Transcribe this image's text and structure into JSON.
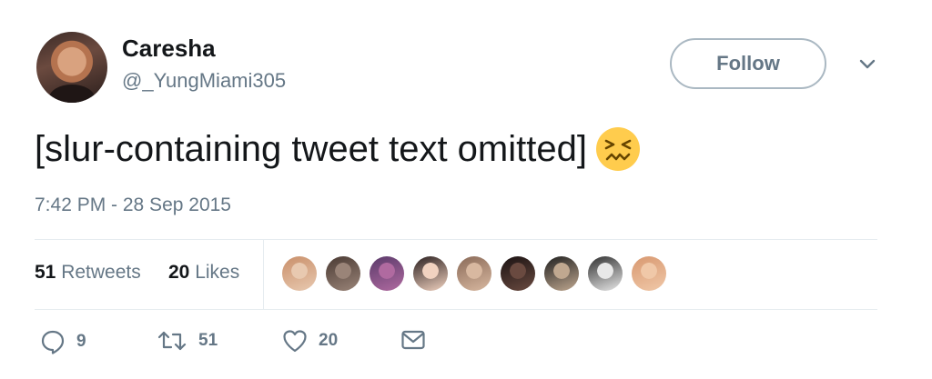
{
  "author": {
    "display_name": "Caresha",
    "handle": "@_YungMiami305"
  },
  "follow_label": "Follow",
  "tweet": {
    "text": "[slur-containing tweet text omitted]",
    "emoji": "confounded-face",
    "timestamp": "7:42 PM - 28 Sep 2015"
  },
  "stats": {
    "retweets_count": "51",
    "retweets_label": "Retweets",
    "likes_count": "20",
    "likes_label": "Likes"
  },
  "likers": [
    {
      "name": "liker-avatar-1",
      "colors": [
        "#e8c9b0",
        "#c98f6a"
      ]
    },
    {
      "name": "liker-avatar-2",
      "colors": [
        "#9a8478",
        "#4a3a33"
      ]
    },
    {
      "name": "liker-avatar-3",
      "colors": [
        "#b06aa0",
        "#5a3a6a"
      ]
    },
    {
      "name": "liker-avatar-4",
      "colors": [
        "#f1d2c0",
        "#2b2020"
      ]
    },
    {
      "name": "liker-avatar-5",
      "colors": [
        "#d8b8a0",
        "#8a6a58"
      ]
    },
    {
      "name": "liker-avatar-6",
      "colors": [
        "#6a4a40",
        "#1a1212"
      ]
    },
    {
      "name": "liker-avatar-7",
      "colors": [
        "#c0a890",
        "#202020"
      ]
    },
    {
      "name": "liker-avatar-8",
      "colors": [
        "#e8e8e8",
        "#303030"
      ]
    },
    {
      "name": "liker-avatar-9",
      "colors": [
        "#f0c8a8",
        "#d89870"
      ]
    }
  ],
  "actions": {
    "reply_count": "9",
    "retweet_count": "51",
    "like_count": "20"
  },
  "colors": {
    "text_primary": "#14171a",
    "text_secondary": "#657786",
    "border": "#aab8c2",
    "divider": "#e6ecf0"
  },
  "icons": [
    "reply-icon",
    "retweet-icon",
    "heart-icon",
    "envelope-icon",
    "chevron-down-icon",
    "confounded-face-emoji"
  ]
}
